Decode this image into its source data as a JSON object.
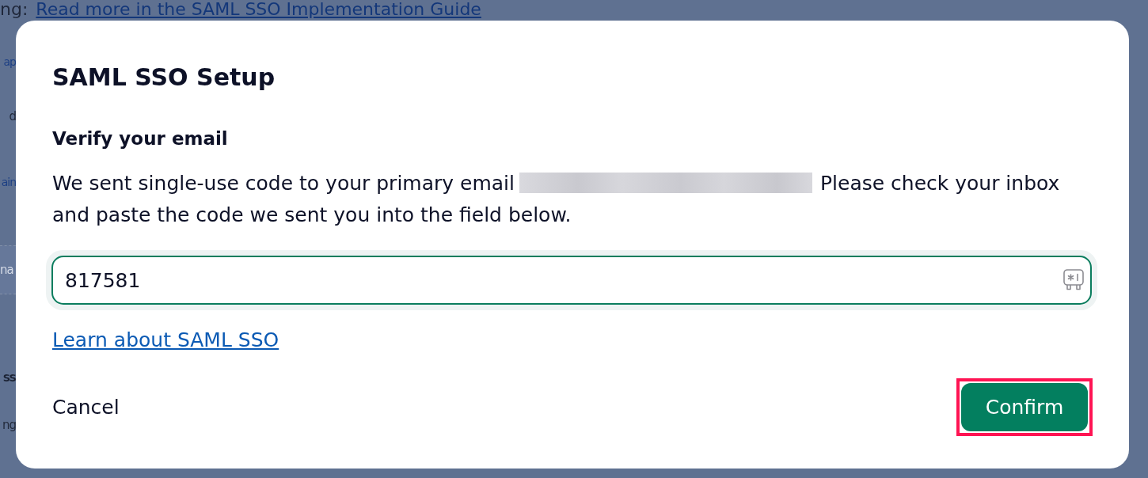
{
  "background": {
    "note": "ng:",
    "link": "Read more in the SAML SSO Implementation Guide",
    "fragments": [
      {
        "kind": "link",
        "text": "ap"
      },
      {
        "kind": "text",
        "text": "d"
      },
      {
        "kind": "link",
        "text": "ain"
      },
      {
        "kind": "field",
        "placeholder": "na"
      },
      {
        "kind": "heading",
        "text": "SS"
      },
      {
        "kind": "text",
        "text": "ng"
      }
    ]
  },
  "dialog": {
    "title": "SAML SSO Setup",
    "heading": "Verify your email",
    "message_lines": [
      {
        "text": "We sent single-use code to your primary email",
        "redacted_email": true,
        "text_after": "Please check your inbox"
      },
      {
        "text": "and paste the code we sent you into the field below.",
        "redacted_email": false
      }
    ],
    "code_field": {
      "value": "817581",
      "focused": true
    },
    "link": "Learn about SAML SSO",
    "cancel_button": "Cancel",
    "confirm_button": {
      "label": "Confirm",
      "highlighted": true
    }
  }
}
